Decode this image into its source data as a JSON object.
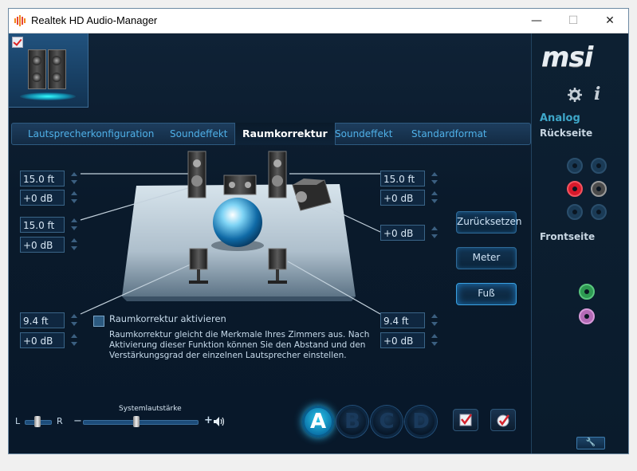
{
  "window": {
    "title": "Realtek HD Audio-Manager",
    "minimize_icon": "minimize-icon",
    "maximize_icon": "maximize-icon",
    "close_icon": "close-icon",
    "controls": {
      "minimize": "—",
      "maximize": "☐",
      "close": "✕"
    }
  },
  "tabs": [
    {
      "label": "Lautsprecherkonfiguration",
      "active": false
    },
    {
      "label": "Soundeffekt",
      "active": false
    },
    {
      "label": "Raumkorrektur",
      "active": true
    },
    {
      "label": "Soundeffekt",
      "active": false
    },
    {
      "label": "Standardformat",
      "active": false
    }
  ],
  "speakers": {
    "front_left": {
      "distance": "15.0 ft",
      "gain": "+0 dB"
    },
    "center": {
      "distance": "15.0 ft",
      "gain": "+0 dB"
    },
    "front_right": {
      "distance": "15.0 ft",
      "gain": "+0 dB"
    },
    "subwoofer": {
      "gain": "+0 dB"
    },
    "rear_left": {
      "distance": "9.4 ft",
      "gain": "+0 dB"
    },
    "rear_right": {
      "distance": "9.4 ft",
      "gain": "+0 dB"
    }
  },
  "buttons": {
    "reset": "Zurücksetzen",
    "meter": "Meter",
    "foot": "Fuß"
  },
  "room_correction": {
    "checkbox_label": "Raumkorrektur aktivieren",
    "checked": false,
    "description": "Raumkorrektur gleicht die Merkmale Ihres Zimmers aus. Nach Aktivierung dieser Funktion können Sie den Abstand und den Verstärkungsgrad der einzelnen Lautsprecher einstellen."
  },
  "volume": {
    "label": "Systemlautstärke",
    "balance_left": "L",
    "balance_right": "R",
    "minus": "−",
    "plus": "+",
    "level": 0.47,
    "balance": 0.5,
    "speaker_icon": "speaker-volume-icon"
  },
  "profiles": [
    "A",
    "B",
    "C",
    "D"
  ],
  "active_profile": "A",
  "sidebar": {
    "brand": "msi",
    "analog_label": "Analog",
    "rear_label": "Rückseite",
    "front_label": "Frontseite",
    "gear_icon": "gear-icon",
    "info_icon": "info-icon",
    "info_glyph": "i",
    "wrench_glyph": "🔧"
  },
  "colors": {
    "accent": "#2bb6e8",
    "background": "#0b1a2a",
    "jack_red": "#d8192b",
    "jack_green": "#2e9a52",
    "jack_pink": "#b46ab6"
  }
}
